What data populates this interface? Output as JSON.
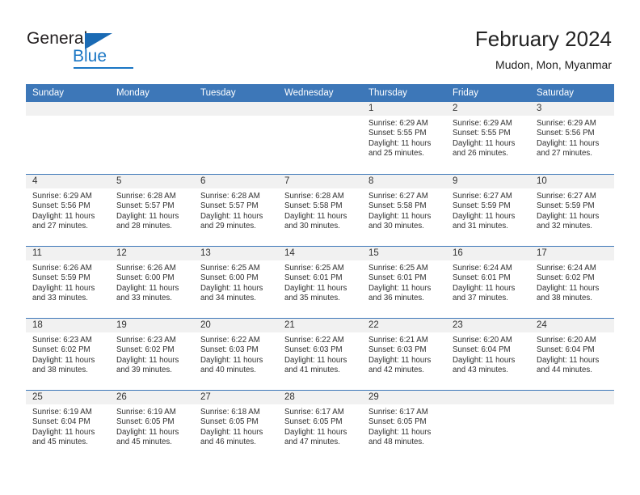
{
  "brand": {
    "name_part1": "General",
    "name_part2": "Blue",
    "triangle_icon": "triangle-icon",
    "colors": {
      "dark_text": "#231f20",
      "blue": "#1a76c4",
      "header_blue": "#3d77b8",
      "day_band_gray": "#f1f1f1"
    }
  },
  "header": {
    "title": "February 2024",
    "subtitle": "Mudon, Mon, Myanmar"
  },
  "calendar": {
    "weekdays": [
      "Sunday",
      "Monday",
      "Tuesday",
      "Wednesday",
      "Thursday",
      "Friday",
      "Saturday"
    ],
    "weeks": [
      [
        {
          "day": "",
          "lines": []
        },
        {
          "day": "",
          "lines": []
        },
        {
          "day": "",
          "lines": []
        },
        {
          "day": "",
          "lines": []
        },
        {
          "day": "1",
          "lines": [
            "Sunrise: 6:29 AM",
            "Sunset: 5:55 PM",
            "Daylight: 11 hours",
            "and 25 minutes."
          ]
        },
        {
          "day": "2",
          "lines": [
            "Sunrise: 6:29 AM",
            "Sunset: 5:55 PM",
            "Daylight: 11 hours",
            "and 26 minutes."
          ]
        },
        {
          "day": "3",
          "lines": [
            "Sunrise: 6:29 AM",
            "Sunset: 5:56 PM",
            "Daylight: 11 hours",
            "and 27 minutes."
          ]
        }
      ],
      [
        {
          "day": "4",
          "lines": [
            "Sunrise: 6:29 AM",
            "Sunset: 5:56 PM",
            "Daylight: 11 hours",
            "and 27 minutes."
          ]
        },
        {
          "day": "5",
          "lines": [
            "Sunrise: 6:28 AM",
            "Sunset: 5:57 PM",
            "Daylight: 11 hours",
            "and 28 minutes."
          ]
        },
        {
          "day": "6",
          "lines": [
            "Sunrise: 6:28 AM",
            "Sunset: 5:57 PM",
            "Daylight: 11 hours",
            "and 29 minutes."
          ]
        },
        {
          "day": "7",
          "lines": [
            "Sunrise: 6:28 AM",
            "Sunset: 5:58 PM",
            "Daylight: 11 hours",
            "and 30 minutes."
          ]
        },
        {
          "day": "8",
          "lines": [
            "Sunrise: 6:27 AM",
            "Sunset: 5:58 PM",
            "Daylight: 11 hours",
            "and 30 minutes."
          ]
        },
        {
          "day": "9",
          "lines": [
            "Sunrise: 6:27 AM",
            "Sunset: 5:59 PM",
            "Daylight: 11 hours",
            "and 31 minutes."
          ]
        },
        {
          "day": "10",
          "lines": [
            "Sunrise: 6:27 AM",
            "Sunset: 5:59 PM",
            "Daylight: 11 hours",
            "and 32 minutes."
          ]
        }
      ],
      [
        {
          "day": "11",
          "lines": [
            "Sunrise: 6:26 AM",
            "Sunset: 5:59 PM",
            "Daylight: 11 hours",
            "and 33 minutes."
          ]
        },
        {
          "day": "12",
          "lines": [
            "Sunrise: 6:26 AM",
            "Sunset: 6:00 PM",
            "Daylight: 11 hours",
            "and 33 minutes."
          ]
        },
        {
          "day": "13",
          "lines": [
            "Sunrise: 6:25 AM",
            "Sunset: 6:00 PM",
            "Daylight: 11 hours",
            "and 34 minutes."
          ]
        },
        {
          "day": "14",
          "lines": [
            "Sunrise: 6:25 AM",
            "Sunset: 6:01 PM",
            "Daylight: 11 hours",
            "and 35 minutes."
          ]
        },
        {
          "day": "15",
          "lines": [
            "Sunrise: 6:25 AM",
            "Sunset: 6:01 PM",
            "Daylight: 11 hours",
            "and 36 minutes."
          ]
        },
        {
          "day": "16",
          "lines": [
            "Sunrise: 6:24 AM",
            "Sunset: 6:01 PM",
            "Daylight: 11 hours",
            "and 37 minutes."
          ]
        },
        {
          "day": "17",
          "lines": [
            "Sunrise: 6:24 AM",
            "Sunset: 6:02 PM",
            "Daylight: 11 hours",
            "and 38 minutes."
          ]
        }
      ],
      [
        {
          "day": "18",
          "lines": [
            "Sunrise: 6:23 AM",
            "Sunset: 6:02 PM",
            "Daylight: 11 hours",
            "and 38 minutes."
          ]
        },
        {
          "day": "19",
          "lines": [
            "Sunrise: 6:23 AM",
            "Sunset: 6:02 PM",
            "Daylight: 11 hours",
            "and 39 minutes."
          ]
        },
        {
          "day": "20",
          "lines": [
            "Sunrise: 6:22 AM",
            "Sunset: 6:03 PM",
            "Daylight: 11 hours",
            "and 40 minutes."
          ]
        },
        {
          "day": "21",
          "lines": [
            "Sunrise: 6:22 AM",
            "Sunset: 6:03 PM",
            "Daylight: 11 hours",
            "and 41 minutes."
          ]
        },
        {
          "day": "22",
          "lines": [
            "Sunrise: 6:21 AM",
            "Sunset: 6:03 PM",
            "Daylight: 11 hours",
            "and 42 minutes."
          ]
        },
        {
          "day": "23",
          "lines": [
            "Sunrise: 6:20 AM",
            "Sunset: 6:04 PM",
            "Daylight: 11 hours",
            "and 43 minutes."
          ]
        },
        {
          "day": "24",
          "lines": [
            "Sunrise: 6:20 AM",
            "Sunset: 6:04 PM",
            "Daylight: 11 hours",
            "and 44 minutes."
          ]
        }
      ],
      [
        {
          "day": "25",
          "lines": [
            "Sunrise: 6:19 AM",
            "Sunset: 6:04 PM",
            "Daylight: 11 hours",
            "and 45 minutes."
          ]
        },
        {
          "day": "26",
          "lines": [
            "Sunrise: 6:19 AM",
            "Sunset: 6:05 PM",
            "Daylight: 11 hours",
            "and 45 minutes."
          ]
        },
        {
          "day": "27",
          "lines": [
            "Sunrise: 6:18 AM",
            "Sunset: 6:05 PM",
            "Daylight: 11 hours",
            "and 46 minutes."
          ]
        },
        {
          "day": "28",
          "lines": [
            "Sunrise: 6:17 AM",
            "Sunset: 6:05 PM",
            "Daylight: 11 hours",
            "and 47 minutes."
          ]
        },
        {
          "day": "29",
          "lines": [
            "Sunrise: 6:17 AM",
            "Sunset: 6:05 PM",
            "Daylight: 11 hours",
            "and 48 minutes."
          ]
        },
        {
          "day": "",
          "lines": []
        },
        {
          "day": "",
          "lines": []
        }
      ]
    ]
  }
}
